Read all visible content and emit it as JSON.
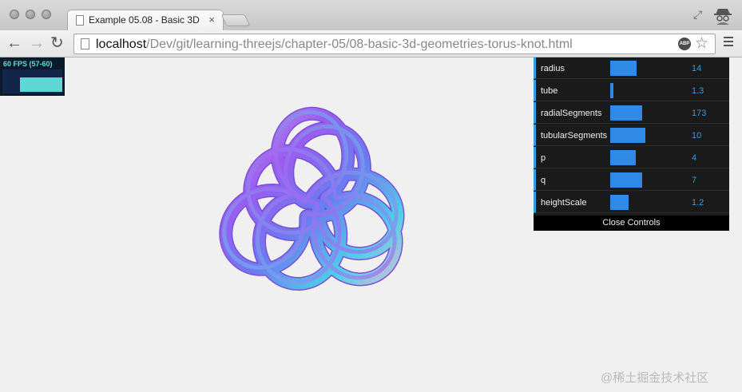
{
  "browser": {
    "tab_title": "Example 05.08 - Basic 3D",
    "tab_close": "×",
    "url_host": "localhost",
    "url_path": "/Dev/git/learning-threejs/chapter-05/08-basic-3d-geometries-torus-knot.html",
    "abp_label": "ABP"
  },
  "stats": {
    "text": "60 FPS (57-60)",
    "level": 0.6
  },
  "controls": {
    "items": [
      {
        "label": "radius",
        "value": "14",
        "fill": 0.37
      },
      {
        "label": "tube",
        "value": "1.3",
        "fill": 0.04
      },
      {
        "label": "radialSegments",
        "value": "173",
        "fill": 0.46
      },
      {
        "label": "tubularSegments",
        "value": "10",
        "fill": 0.5
      },
      {
        "label": "p",
        "value": "4",
        "fill": 0.36
      },
      {
        "label": "q",
        "value": "7",
        "fill": 0.46
      },
      {
        "label": "heightScale",
        "value": "1.2",
        "fill": 0.26
      }
    ],
    "close_label": "Close Controls"
  },
  "watermark": "@稀土掘金技术社区",
  "colors": {
    "accent": "#2f9ce6",
    "slider_fill": "#2f89e6",
    "knot_stops": [
      "#c79ce6",
      "#9a5cf0",
      "#6a7cf0",
      "#4fd0e8",
      "#d8bcd8"
    ]
  }
}
